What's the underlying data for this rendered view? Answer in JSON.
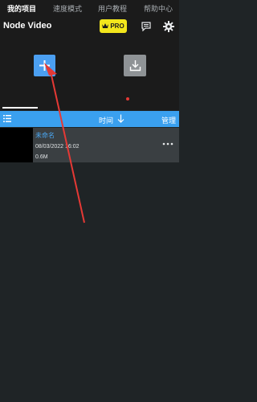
{
  "header": {
    "app_title": "Node Video",
    "pro_label": "PRO",
    "crown_icon": "crown-icon",
    "chat_icon": "chat-icon",
    "settings_icon": "gear-icon"
  },
  "actions": {
    "add_icon": "plus-icon",
    "import_icon": "download-icon"
  },
  "tabs": [
    {
      "label": "我的项目",
      "active": true
    },
    {
      "label": "速度模式",
      "active": false
    },
    {
      "label": "用户教程",
      "active": false,
      "notification_dot": true
    },
    {
      "label": "帮助中心",
      "active": false
    }
  ],
  "sort_bar": {
    "sort_label": "时间",
    "manage_label": "管理"
  },
  "projects": [
    {
      "name": "未命名",
      "date": "08/03/2022 16:02",
      "size": "0.6M"
    }
  ],
  "colors": {
    "accent_blue": "#3aa0ef",
    "pro_yellow": "#f3e61c",
    "annotation_red": "#e53935"
  }
}
